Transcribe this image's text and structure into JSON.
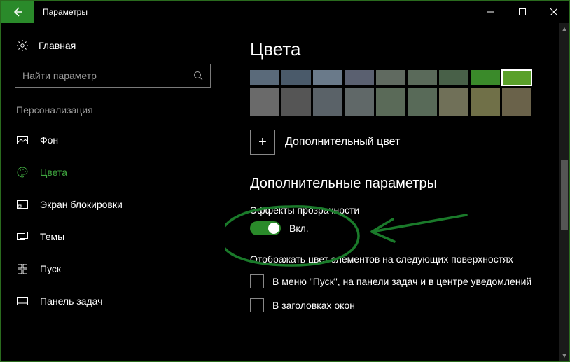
{
  "window": {
    "title": "Параметры"
  },
  "sidebar": {
    "home": "Главная",
    "search_placeholder": "Найти параметр",
    "group": "Персонализация",
    "items": [
      {
        "label": "Фон"
      },
      {
        "label": "Цвета"
      },
      {
        "label": "Экран блокировки"
      },
      {
        "label": "Темы"
      },
      {
        "label": "Пуск"
      },
      {
        "label": "Панель задач"
      }
    ]
  },
  "content": {
    "heading": "Цвета",
    "swatches_row1": [
      "#5a6a7a",
      "#4a5a6a",
      "#6a7a8a",
      "#5a6070",
      "#606a60",
      "#5a6a5a",
      "#486048",
      "#3a8a2a",
      "#5aa02a"
    ],
    "swatches_row2": [
      "#6a6a6a",
      "#555555",
      "#5a6268",
      "#606868",
      "#5a6a58",
      "#586a58",
      "#707058",
      "#707048",
      "#6a624a"
    ],
    "selected_swatch": 8,
    "custom_color": "Дополнительный цвет",
    "more_heading": "Дополнительные параметры",
    "transparency_label": "Эффекты прозрачности",
    "toggle_state": "Вкл.",
    "surfaces_label": "Отображать цвет элементов на следующих поверхностях",
    "checks": [
      {
        "label": "В меню \"Пуск\", на панели задач и в центре уведомлений"
      },
      {
        "label": "В заголовках окон"
      }
    ]
  },
  "colors": {
    "accent": "#2a8a2a",
    "annotation": "#1a7a2a"
  }
}
